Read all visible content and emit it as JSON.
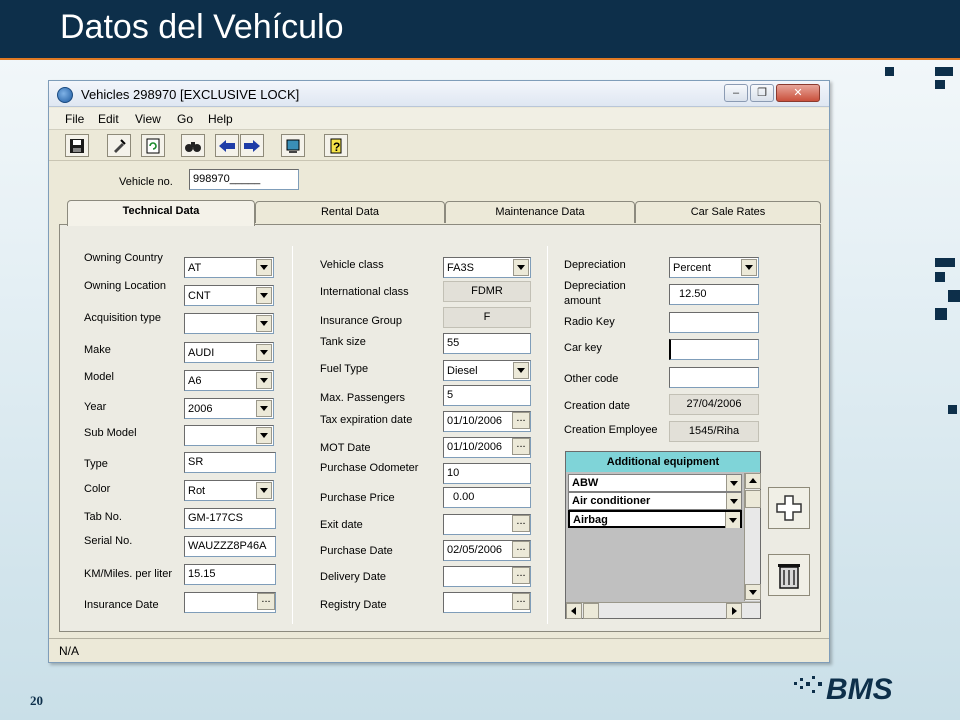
{
  "slide": {
    "title": "Datos del Vehículo",
    "page_number": "20",
    "logo_text": "BMS"
  },
  "window": {
    "title": "Vehicles  298970  [EXCLUSIVE LOCK]",
    "buttons": [
      "minimize-icon",
      "restore-icon",
      "close-icon"
    ]
  },
  "menu": [
    "File",
    "Edit",
    "View",
    "Go",
    "Help"
  ],
  "toolbar": [
    "save-icon",
    "clear-icon",
    "refresh-icon",
    "search-icon",
    "back-icon",
    "forward-icon",
    "export-icon",
    "help-icon"
  ],
  "vehicle_no": {
    "label": "Vehicle no.",
    "value": "998970_____"
  },
  "tabs": [
    "Technical Data",
    "Rental Data",
    "Maintenance Data",
    "Car Sale Rates"
  ],
  "col1": {
    "owning_country": {
      "label": "Owning Country",
      "value": "AT"
    },
    "owning_location": {
      "label": "Owning Location",
      "value": "CNT"
    },
    "acquisition_type": {
      "label": "Acquisition type",
      "value": ""
    },
    "make": {
      "label": "Make",
      "value": "AUDI"
    },
    "model": {
      "label": "Model",
      "value": "A6"
    },
    "year": {
      "label": "Year",
      "value": "2006"
    },
    "sub_model": {
      "label": "Sub Model",
      "value": ""
    },
    "type": {
      "label": "Type",
      "value": "SR"
    },
    "color": {
      "label": "Color",
      "value": "Rot"
    },
    "tab_no": {
      "label": "Tab No.",
      "value": "GM-177CS"
    },
    "serial_no": {
      "label": "Serial No.",
      "value": "WAUZZZ8P46A"
    },
    "km_per_liter": {
      "label": "KM/Miles. per liter",
      "value": "15.15"
    },
    "insurance_date": {
      "label": "Insurance Date",
      "value": ""
    }
  },
  "col2": {
    "vehicle_class": {
      "label": "Vehicle class",
      "value": "FA3S"
    },
    "international_class": {
      "label": "International class",
      "value": "FDMR"
    },
    "insurance_group": {
      "label": "Insurance Group",
      "value": "F"
    },
    "tank_size": {
      "label": "Tank size",
      "value": "55"
    },
    "fuel_type": {
      "label": "Fuel Type",
      "value": "Diesel"
    },
    "max_passengers": {
      "label": "Max. Passengers",
      "value": "5"
    },
    "tax_expiration": {
      "label": "Tax expiration date",
      "value": "01/10/2006"
    },
    "mot_date": {
      "label": "MOT Date",
      "value": "01/10/2006"
    },
    "purchase_odometer": {
      "label": "Purchase Odometer",
      "value": "10"
    },
    "purchase_price": {
      "label": "Purchase Price",
      "value": "0.00"
    },
    "exit_date": {
      "label": "Exit date",
      "value": ""
    },
    "purchase_date": {
      "label": "Purchase Date",
      "value": "02/05/2006"
    },
    "delivery_date": {
      "label": "Delivery Date",
      "value": ""
    },
    "registry_date": {
      "label": "Registry Date",
      "value": ""
    }
  },
  "col3": {
    "depreciation": {
      "label": "Depreciation",
      "value": "Percent"
    },
    "depreciation_amount": {
      "label1": "Depreciation",
      "label2": "amount",
      "value": "12.50"
    },
    "radio_key": {
      "label": "Radio Key",
      "value": ""
    },
    "car_key": {
      "label": "Car key",
      "value": ""
    },
    "other_code": {
      "label": "Other code",
      "value": ""
    },
    "creation_date": {
      "label": "Creation date",
      "value": "27/04/2006"
    },
    "creation_employee": {
      "label": "Creation Employee",
      "value": "1545/Riha"
    }
  },
  "equipment": {
    "header": "Additional equipment",
    "items": [
      "ABW",
      "Air conditioner",
      "Airbag"
    ]
  },
  "status": {
    "text": "N/A"
  },
  "date_button_label": "..."
}
